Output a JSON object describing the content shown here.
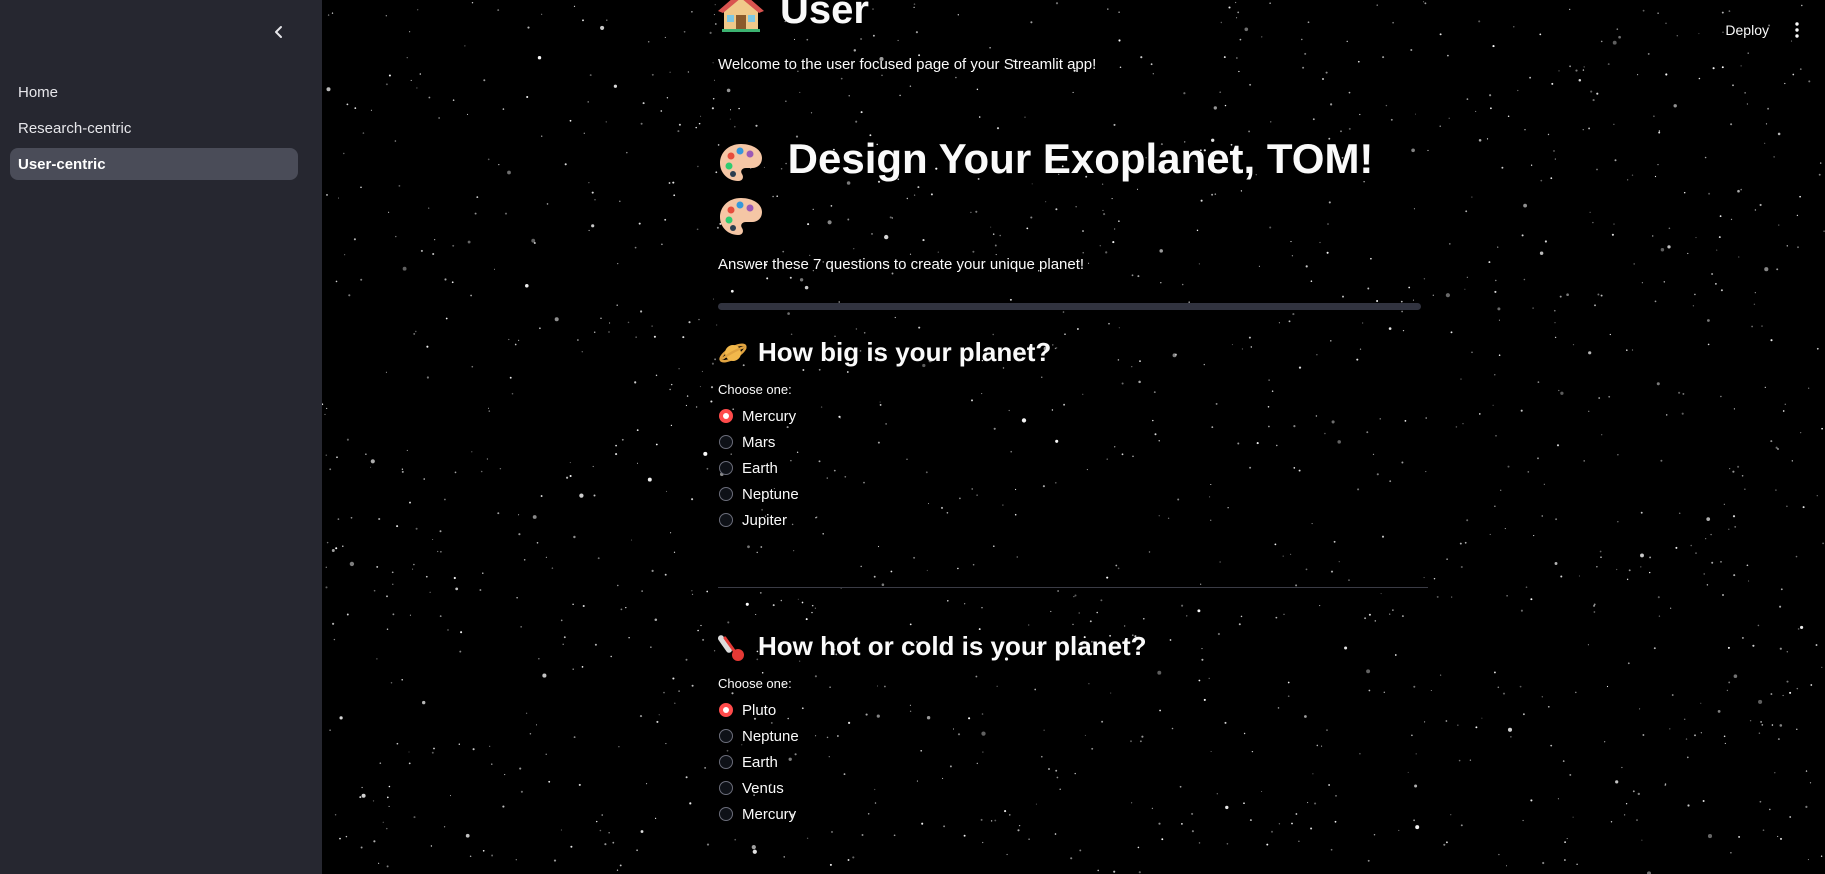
{
  "sidebar": {
    "collapse_icon": "chevron-left-icon",
    "items": [
      {
        "label": "Home",
        "active": false
      },
      {
        "label": "Research-centric",
        "active": false
      },
      {
        "label": "User-centric",
        "active": true
      }
    ]
  },
  "topbar": {
    "deploy_label": "Deploy",
    "menu_icon": "vertical-dots-icon"
  },
  "page": {
    "title": "User",
    "title_icon": "house-icon",
    "subtitle": "Welcome to the user focused page of your Streamlit app!"
  },
  "designer": {
    "heading": "Design Your Exoplanet, TOM!",
    "heading_icon": "artist-palette-icon",
    "instructions": "Answer these 7 questions to create your unique planet!",
    "progress": 0
  },
  "questions": [
    {
      "icon": "ringed-planet-icon",
      "title": "How big is your planet?",
      "label": "Choose one:",
      "options": [
        "Mercury",
        "Mars",
        "Earth",
        "Neptune",
        "Jupiter"
      ],
      "selected": "Mercury"
    },
    {
      "icon": "thermometer-icon",
      "title": "How hot or cold is your planet?",
      "label": "Choose one:",
      "options": [
        "Pluto",
        "Neptune",
        "Earth",
        "Venus",
        "Mercury"
      ],
      "selected": "Pluto"
    }
  ],
  "colors": {
    "accent": "#ff4b4b",
    "sidebar_bg": "#262730",
    "main_bg": "#000000"
  }
}
